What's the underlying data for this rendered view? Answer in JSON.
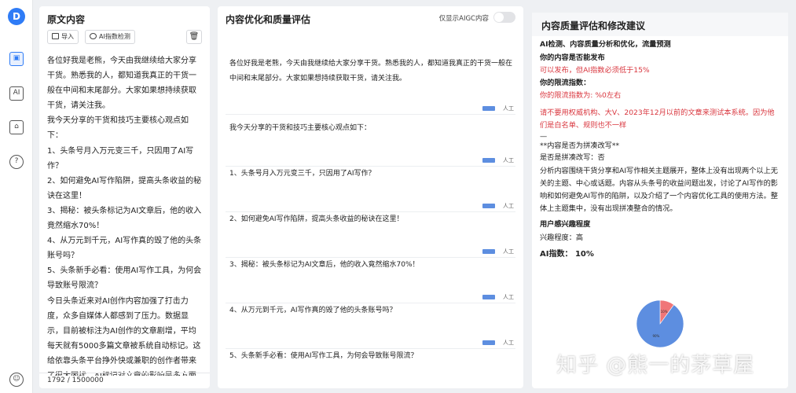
{
  "logo": "D",
  "sidebar": {
    "ai_icon_label": "AI"
  },
  "orig": {
    "title": "原文内容",
    "import_label": "导入",
    "aicheck_label": "AI指数检测",
    "paragraphs": [
      "各位好我是老熊，今天由我继续给大家分享干货。熟悉我的人，都知道我真正的干货一般在中间和末尾部分。大家如果想持续获取干货，请关注我。",
      "我今天分享的干货和技巧主要核心观点如下：",
      "1、头条号月入万元变三千，只因用了AI写作？",
      "  2、如何避免AI写作陷阱，提高头条收益的秘诀在这里！",
      "  3、揭秘：被头条标记为AI文章后，他的收入竟然缩水70%！",
      "  4、从万元到千元，AI写作真的毁了他的头条账号吗？",
      "  5、头条新手必看：使用AI写作工具，为何会导致账号限流？",
      "今日头条近来对AI创作内容加强了打击力度，众多自媒体人都感到了压力。数据显示，目前被标注为AI创作的文章剧增，平均每天就有5000多篇文章被系统自动标记。这给依靠头条平台挣外快或兼职的创作者带来了很大困扰。AI标记对文章的影响是多方面的"
    ],
    "counter": "1792 / 1500000"
  },
  "opt": {
    "title": "内容优化和质量评估",
    "toggle_label": "仅显示AIGC内容",
    "tag": "人工",
    "segments": [
      "各位好我是老熊，今天由我继续给大家分享干货。熟悉我的人，都知道我真正的干货一般在中间和末尾部分。大家如果想持续获取干货，请关注我。",
      "我今天分享的干货和技巧主要核心观点如下：",
      "1、头条号月入万元变三千，只因用了AI写作？",
      "2、如何避免AI写作陷阱，提高头条收益的秘诀在这里！",
      "3、揭秘：被头条标记为AI文章后，他的收入竟然缩水70%！",
      "4、从万元到千元，AI写作真的毁了他的头条账号吗？",
      "5、头条新手必看：使用AI写作工具，为何会导致账号限流？"
    ]
  },
  "eval": {
    "title": "内容质量评估和修改建议",
    "heading": "AI检测、内容质量分析和优化，流量预测",
    "publish_q": "你的内容是否能发布",
    "publish_a": "可以发布，但AI指数必须低于15%",
    "limit_q": "你的限流指数：",
    "limit_a": "你的限流指数为: %0左右",
    "warning": "请不要用权威机构、大V、2023年12月以前的文章来测试本系统。因为他们是白名单、规则也不一样",
    "divider": "—",
    "patch_q": "**内容是否为拼凑改写**",
    "patch_a": "是否是拼凑改写：否",
    "analysis": "分析内容围绕干货分享和AI写作相关主题展开，整体上没有出现两个以上无关的主题、中心或话题。内容从头条号的收益问题出发，讨论了AI写作的影响和如何避免AI写作的陷阱，以及介绍了一个内容优化工具的使用方法。整体上主题集中，没有出现拼凑整合的情况。",
    "interest_q": "用户感兴趣程度",
    "interest_a": "兴趣程度：高",
    "ai_index": "AI指数：  10%"
  },
  "chart_data": {
    "type": "pie",
    "categories": [
      "AI",
      "人工"
    ],
    "values": [
      10,
      90
    ],
    "labels": [
      "10%",
      "90%"
    ],
    "colors": [
      "#f07678",
      "#5d8ee0"
    ]
  },
  "watermark": "知乎 @熊一的茅草屋"
}
